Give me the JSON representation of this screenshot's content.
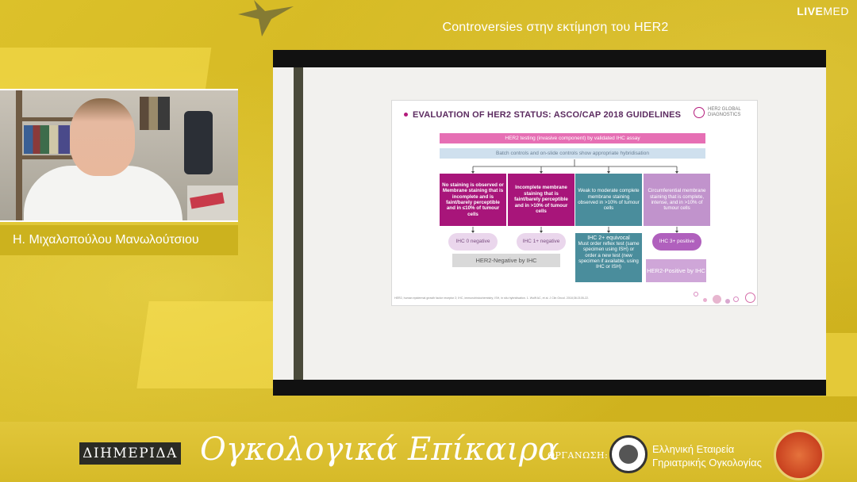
{
  "header": {
    "title": "Controversies στην εκτίμηση του HER2",
    "logo_bold": "LIVE",
    "logo_rest": "MED"
  },
  "speaker": {
    "name": "Η. Μιχαλοπούλου Μανωλούτσιου"
  },
  "slide": {
    "heading": "EVALUATION OF HER2 STATUS: ASCO/CAP 2018 GUIDELINES",
    "brand": "HER2 GLOBAL DIAGNOSTICS",
    "bar_testing": "HER2 testing (invasive component) by validated IHC assay",
    "bar_controls": "Batch controls and on-slide controls show appropriate hybridisation",
    "boxes": [
      "No staining is observed or Membrane staining that is incomplete and is faint/barely perceptible and in ≤10% of tumour cells",
      "Incomplete membrane staining that is faint/barely perceptible and in >10% of tumour cells",
      "Weak to moderate complete membrane staining observed in >10% of tumour cells",
      "Circumferential membrane staining that is complete, intense, and in >10% of tumour cells"
    ],
    "results": [
      "IHC 0 negative",
      "IHC 1+ negative",
      "IHC 2+ equivocal",
      "IHC 3+ positive"
    ],
    "equivocal_note": "Must order reflex test (same specimen using ISH) or order a new test (new specimen if available, using IHC or ISH)",
    "negative_label": "HER2-Negative by IHC",
    "positive_label": "HER2-Positive by IHC",
    "footnote": "HER2, human epidermal growth factor receptor 2; IHC, immunohistochemistry; ISH, in situ hybridisation. 1. Wolff AC, et al. J Clin Oncol. 2018;36:2105-22."
  },
  "banner": {
    "dimerida": "ΔΙΗΜΕΡΙΔΑ",
    "event_title": "Ογκολογικά Επίκαιρα",
    "organizer_label": "ΟΡΓΑΝΩΣΗ:",
    "organizer_line1": "Ελληνική Εταιρεία",
    "organizer_line2": "Γηριατρικής Ογκολογίας"
  },
  "colors": {
    "background": "#d9bf22",
    "accent_magenta": "#a8157a",
    "accent_teal": "#4a8d9c",
    "accent_lilac": "#c193cc"
  }
}
